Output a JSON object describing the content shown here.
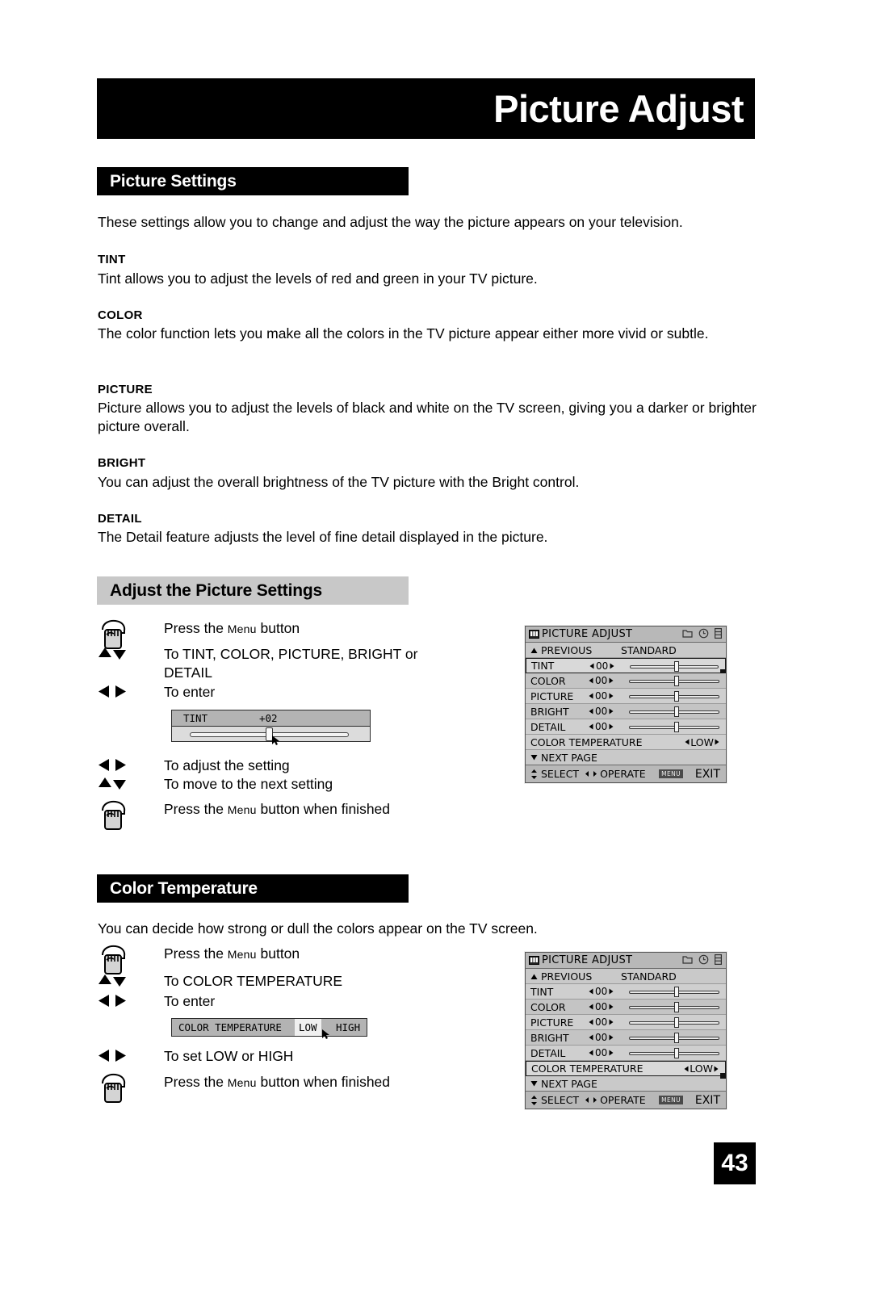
{
  "masthead": {
    "title": "Picture Adjust"
  },
  "sections": {
    "picture_settings": {
      "heading": "Picture Settings",
      "intro": "These settings allow you to change and adjust the way the picture appears on your television.",
      "items": [
        {
          "term": "TINT",
          "desc": "Tint allows you to adjust the levels of red and green in your TV picture."
        },
        {
          "term": "COLOR",
          "desc": "The color function lets you make all the colors in the TV picture appear either more vivid or subtle."
        },
        {
          "term": "PICTURE",
          "desc": "Picture allows you to adjust the levels of black and white on the TV screen, giving you a darker or brighter picture overall."
        },
        {
          "term": "BRIGHT",
          "desc": "You can adjust the overall brightness of the TV picture with the Bright control."
        },
        {
          "term": "DETAIL",
          "desc": "The Detail feature adjusts the level of fine detail displayed in the picture."
        }
      ]
    },
    "adjust_picture": {
      "heading": "Adjust the Picture Settings",
      "steps": [
        {
          "icon": "press-hand-icon",
          "pre": "Press the ",
          "smallcap": "Menu",
          "post": " button"
        },
        {
          "icon": "up-down-arrows-icon",
          "text": "To TINT, COLOR, PICTURE, BRIGHT or DETAIL"
        },
        {
          "icon": "left-right-arrows-icon",
          "text": "To enter"
        },
        {
          "icon": "left-right-arrows-icon",
          "text": "To adjust the setting"
        },
        {
          "icon": "up-down-arrows-icon",
          "text": "To move to the next setting"
        },
        {
          "icon": "press-hand-icon",
          "pre": "Press the ",
          "smallcap": "Menu",
          "post": " button when finished"
        }
      ],
      "tint_popup": {
        "label": "TINT",
        "value": "+02"
      }
    },
    "color_temperature": {
      "heading": "Color Temperature",
      "intro": "You can decide how strong or dull the colors appear on the TV screen.",
      "steps": [
        {
          "icon": "press-hand-icon",
          "pre": "Press the ",
          "smallcap": "Menu",
          "post": " button"
        },
        {
          "icon": "up-down-arrows-icon",
          "text": "To COLOR TEMPERATURE"
        },
        {
          "icon": "left-right-arrows-icon",
          "text": "To enter"
        },
        {
          "icon": "left-right-arrows-icon",
          "text": "To set LOW or HIGH"
        },
        {
          "icon": "press-hand-icon",
          "pre": "Press the ",
          "smallcap": "Menu",
          "post": " button when finished"
        }
      ],
      "ct_popup": {
        "label": "COLOR TEMPERATURE",
        "low": "LOW",
        "high": "HIGH",
        "selected": "LOW"
      }
    }
  },
  "osd": {
    "title": "PICTURE ADJUST",
    "previous": "PREVIOUS",
    "preset": "STANDARD",
    "rows": [
      {
        "name": "TINT",
        "value": "00"
      },
      {
        "name": "COLOR",
        "value": "00"
      },
      {
        "name": "PICTURE",
        "value": "00"
      },
      {
        "name": "BRIGHT",
        "value": "00"
      },
      {
        "name": "DETAIL",
        "value": "00"
      }
    ],
    "color_temperature": {
      "name": "COLOR TEMPERATURE",
      "value": "LOW"
    },
    "next_page": "NEXT PAGE",
    "footer": {
      "select": "SELECT",
      "operate": "OPERATE",
      "menu_chip": "MENU",
      "exit": "EXIT"
    }
  },
  "page_number": "43"
}
